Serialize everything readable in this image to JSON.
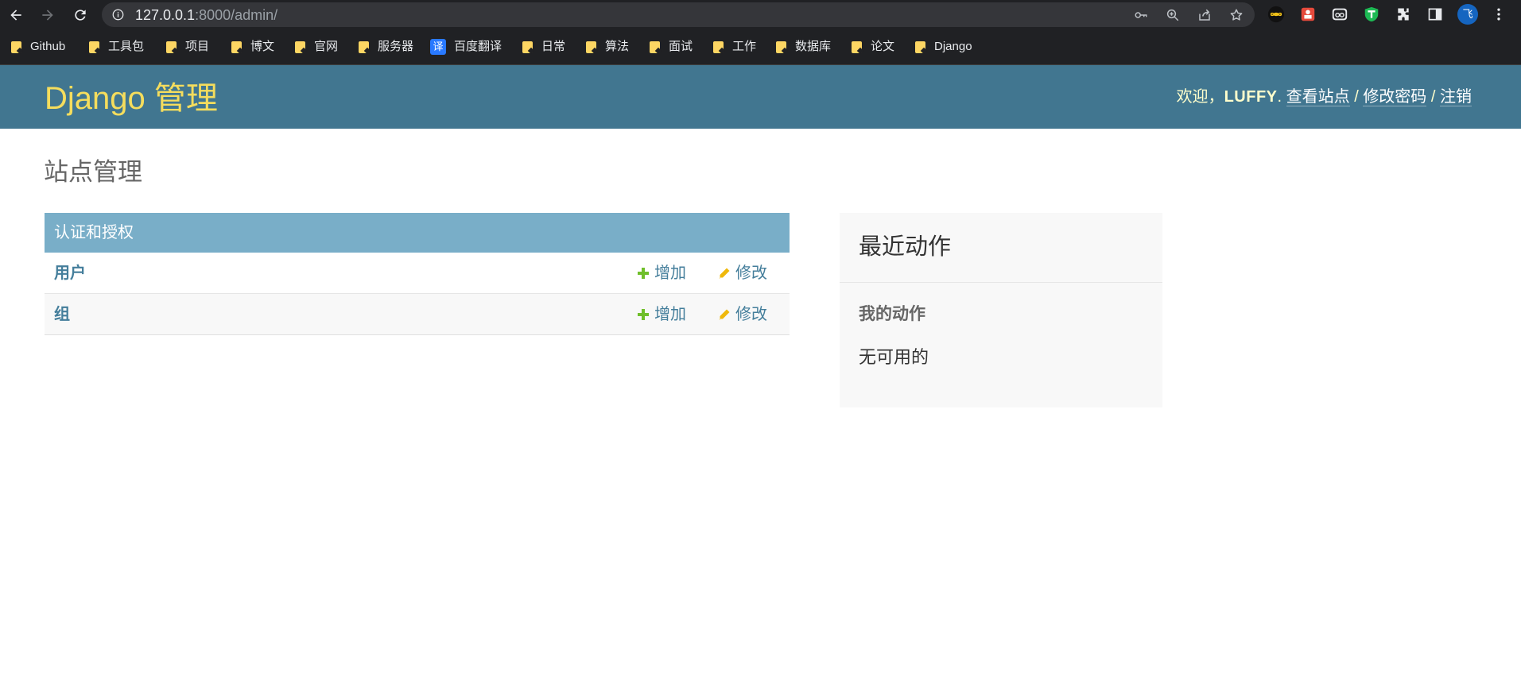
{
  "browser": {
    "url_host": "127.0.0.1",
    "url_rest": ":8000/admin/",
    "bookmarks": [
      {
        "label": "Github",
        "type": "folder"
      },
      {
        "label": "工具包",
        "type": "folder"
      },
      {
        "label": "项目",
        "type": "folder"
      },
      {
        "label": "博文",
        "type": "folder"
      },
      {
        "label": "官网",
        "type": "folder"
      },
      {
        "label": "服务器",
        "type": "folder"
      },
      {
        "label": "百度翻译",
        "type": "translate",
        "badge": "译"
      },
      {
        "label": "日常",
        "type": "folder"
      },
      {
        "label": "算法",
        "type": "folder"
      },
      {
        "label": "面试",
        "type": "folder"
      },
      {
        "label": "工作",
        "type": "folder"
      },
      {
        "label": "数据库",
        "type": "folder"
      },
      {
        "label": "论文",
        "type": "folder"
      },
      {
        "label": "Django",
        "type": "folder"
      }
    ],
    "profile_initial": "飞"
  },
  "header": {
    "brand": "Django 管理",
    "welcome": "欢迎，",
    "username": "LUFFY",
    "username_suffix": ".",
    "view_site": "查看站点",
    "change_password": "修改密码",
    "logout": "注销",
    "separator": "/"
  },
  "content": {
    "title": "站点管理",
    "app_module": {
      "caption": "认证和授权",
      "models": [
        {
          "name": "用户",
          "add_label": "增加",
          "change_label": "修改"
        },
        {
          "name": "组",
          "add_label": "增加",
          "change_label": "修改"
        }
      ]
    },
    "recent_actions": {
      "title": "最近动作",
      "subtitle": "我的动作",
      "empty_text": "无可用的"
    }
  },
  "colors": {
    "header_bg": "#417690",
    "brand": "#f5dd5d",
    "caption_bg": "#79aec8",
    "link": "#447e9b",
    "add_icon": "#70bf2b",
    "change_icon": "#efb80b"
  }
}
